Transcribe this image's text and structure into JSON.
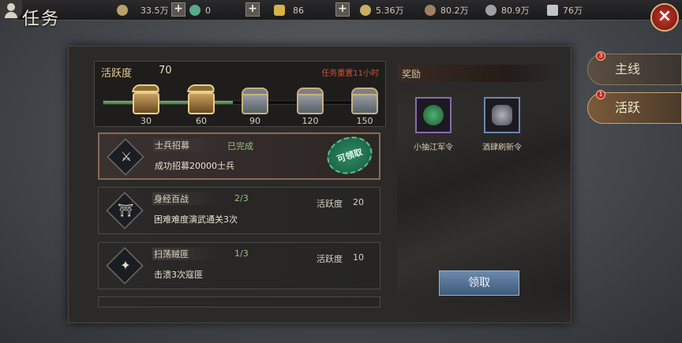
{
  "header": {
    "title": "任务",
    "resources": [
      {
        "name": "copper",
        "value": "33.5万",
        "icon": "copper-coin-icon",
        "color": "#b8a26a"
      },
      {
        "name": "jade",
        "value": "0",
        "icon": "jade-icon",
        "color": "#5aa88a"
      },
      {
        "name": "gold",
        "value": "86",
        "icon": "gold-ingot-icon",
        "color": "#d8b24a"
      },
      {
        "name": "grain",
        "value": "5.36万",
        "icon": "grain-icon",
        "color": "#c8b060"
      },
      {
        "name": "wood",
        "value": "80.2万",
        "icon": "wood-icon",
        "color": "#a08060"
      },
      {
        "name": "stone",
        "value": "80.9万",
        "icon": "stone-icon",
        "color": "#a0a0a0"
      },
      {
        "name": "iron",
        "value": "76万",
        "icon": "iron-icon",
        "color": "#c0c4c8"
      }
    ],
    "plus": "+",
    "close": "×"
  },
  "activity": {
    "label": "活跃度",
    "value": "70",
    "reset_text": "任务重置11小时",
    "progress_fraction": 0.47,
    "milestones": [
      "30",
      "60",
      "90",
      "120",
      "150"
    ]
  },
  "tasks": [
    {
      "name": "士兵招募",
      "status": "已完成",
      "desc": "成功招募20000士兵",
      "claim": "可领取"
    },
    {
      "name": "身经百战",
      "progress": "2/3",
      "desc": "困难难度演武通关3次",
      "points_label": "活跃度",
      "points": "20"
    },
    {
      "name": "扫荡贼匪",
      "progress": "1/3",
      "desc": "击溃3次寇匪",
      "points_label": "活跃度",
      "points": "10"
    }
  ],
  "rewards": {
    "header": "奖励",
    "items": [
      {
        "name": "小抽江军令",
        "icon": "jade-token-icon",
        "color": "#2e8a4e"
      },
      {
        "name": "酒肆刷新令",
        "icon": "stone-token-icon",
        "color": "#8a9098"
      }
    ],
    "claim_button": "领取"
  },
  "side_tabs": [
    {
      "label": "主线",
      "badge": "3"
    },
    {
      "label": "活跃",
      "badge": "1"
    }
  ]
}
